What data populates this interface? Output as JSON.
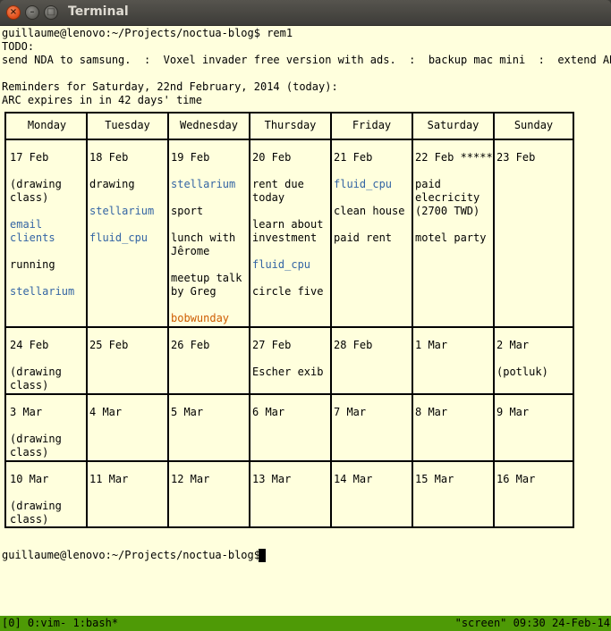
{
  "window": {
    "title": "Terminal"
  },
  "terminal": {
    "lines": [
      "guillaume@lenovo:~/Projects/noctua-blog$ rem1",
      "TODO:",
      "send NDA to samsung.  :  Voxel invader free version with ads.  :  backup mac mini  :  extend ARC",
      "",
      "Reminders for Saturday, 22nd February, 2014 (today):",
      "ARC expires in in 42 days' time"
    ],
    "prompt": "guillaume@lenovo:~/Projects/noctua-blog$ "
  },
  "calendar": {
    "days": [
      "Monday",
      "Tuesday",
      "Wednesday",
      "Thursday",
      "Friday",
      "Saturday",
      "Sunday"
    ],
    "weeks": [
      [
        {
          "date": "17 Feb",
          "items": [
            [
              "(drawing",
              "class)",
              ""
            ],
            [
              "email",
              "clients",
              "blue"
            ],
            [
              "running",
              "",
              ""
            ],
            [
              "stellarium",
              "",
              "blue"
            ]
          ]
        },
        {
          "date": "18 Feb",
          "items": [
            [
              "drawing",
              "",
              ""
            ],
            [
              "stellarium",
              "",
              "blue"
            ],
            [
              "fluid_cpu",
              "",
              "blue"
            ]
          ]
        },
        {
          "date": "19 Feb",
          "items": [
            [
              "stellarium",
              "",
              "blue"
            ],
            [
              "sport",
              "",
              ""
            ],
            [
              "lunch with",
              "Jêrome",
              ""
            ],
            [
              "meetup talk",
              "by Greg",
              ""
            ],
            [
              "bobwunday",
              "",
              "orange"
            ]
          ]
        },
        {
          "date": "20 Feb",
          "items": [
            [
              "rent due",
              "today",
              ""
            ],
            [
              "learn about",
              "investment",
              ""
            ],
            [
              "fluid_cpu",
              "",
              "blue"
            ],
            [
              "circle five",
              "",
              ""
            ]
          ]
        },
        {
          "date": "21 Feb",
          "items": [
            [
              "fluid_cpu",
              "",
              "blue"
            ],
            [
              "clean house",
              "",
              ""
            ],
            [
              "paid rent",
              "",
              ""
            ]
          ]
        },
        {
          "date": "22 Feb *****",
          "items": [
            [
              "paid",
              "elecricity",
              "(2700 TWD)"
            ],
            [
              "motel party",
              "",
              ""
            ]
          ]
        },
        {
          "date": "23 Feb",
          "items": []
        }
      ],
      [
        {
          "date": "24 Feb",
          "items": [
            [
              "(drawing",
              "class)",
              ""
            ]
          ]
        },
        {
          "date": "25 Feb",
          "items": []
        },
        {
          "date": "26 Feb",
          "items": []
        },
        {
          "date": "27 Feb",
          "items": [
            [
              "Escher exib",
              "",
              ""
            ]
          ]
        },
        {
          "date": "28 Feb",
          "items": []
        },
        {
          "date": "1 Mar",
          "items": []
        },
        {
          "date": "2 Mar",
          "items": [
            [
              "(potluk)",
              "",
              ""
            ]
          ]
        }
      ],
      [
        {
          "date": "3 Mar",
          "items": [
            [
              "(drawing",
              "class)",
              ""
            ]
          ]
        },
        {
          "date": "4 Mar",
          "items": []
        },
        {
          "date": "5 Mar",
          "items": []
        },
        {
          "date": "6 Mar",
          "items": []
        },
        {
          "date": "7 Mar",
          "items": []
        },
        {
          "date": "8 Mar",
          "items": []
        },
        {
          "date": "9 Mar",
          "items": []
        }
      ],
      [
        {
          "date": "10 Mar",
          "items": [
            [
              "(drawing",
              "class)",
              ""
            ]
          ]
        },
        {
          "date": "11 Mar",
          "items": []
        },
        {
          "date": "12 Mar",
          "items": []
        },
        {
          "date": "13 Mar",
          "items": []
        },
        {
          "date": "14 Mar",
          "items": []
        },
        {
          "date": "15 Mar",
          "items": []
        },
        {
          "date": "16 Mar",
          "items": []
        }
      ]
    ]
  },
  "statusbar": {
    "left": "[0] 0:vim- 1:bash*",
    "right": "\"screen\" 09:30 24-Feb-14"
  },
  "colors": {
    "terminal_bg": "#ffffdd",
    "link_blue": "#3465a4",
    "highlight_orange": "#ce5c00",
    "status_green": "#4e9a06"
  }
}
